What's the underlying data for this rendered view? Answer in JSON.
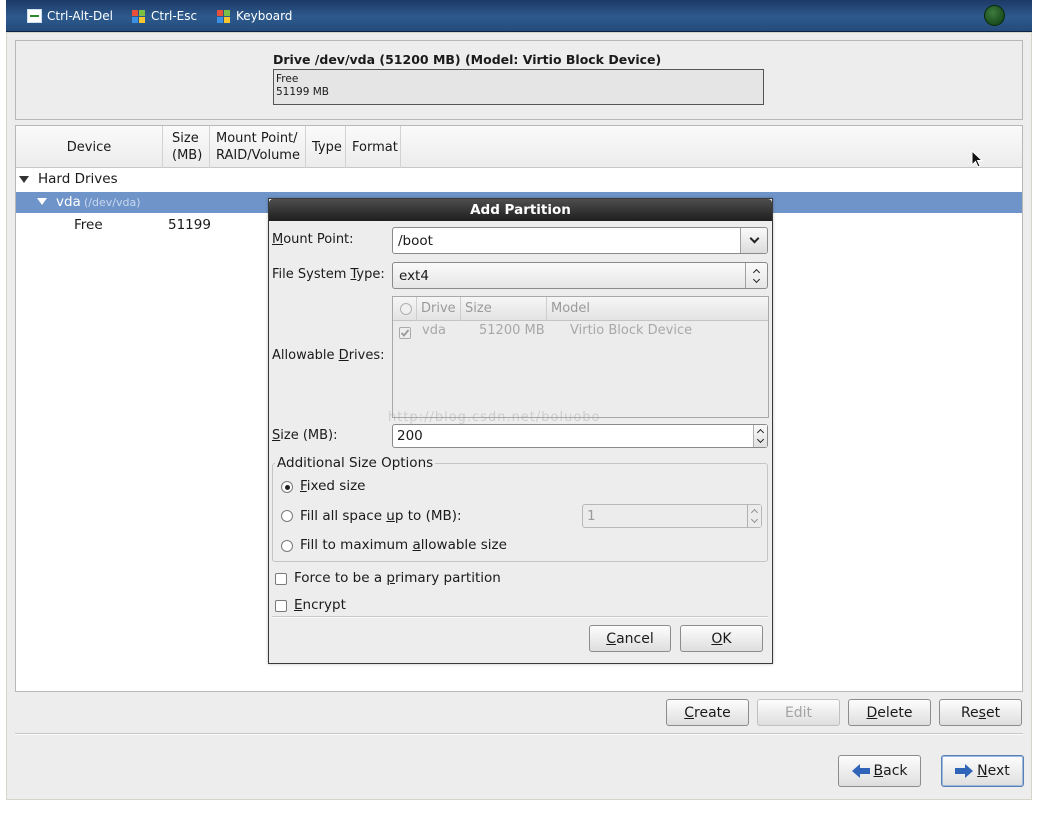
{
  "toolbar": {
    "items": [
      {
        "label": "Ctrl-Alt-Del",
        "icon": "monitor-icon"
      },
      {
        "label": "Ctrl-Esc",
        "icon": "windows-flag-icon"
      },
      {
        "label": "Keyboard",
        "icon": "windows-flag-icon"
      }
    ],
    "status_icon": "connection-led-icon"
  },
  "drive_map": {
    "title": "Drive /dev/vda (51200 MB) (Model: Virtio Block Device)",
    "segment_label": "Free",
    "segment_size": "51199 MB"
  },
  "tree": {
    "columns": [
      "Device",
      "Size\n(MB)",
      "Mount Point/\nRAID/Volume",
      "Type",
      "Format"
    ],
    "col_device": "Device",
    "col_size_1": "Size",
    "col_size_2": "(MB)",
    "col_mount_1": "Mount Point/",
    "col_mount_2": "RAID/Volume",
    "col_type": "Type",
    "col_format": "Format",
    "group": "Hard Drives",
    "drive_name": "vda",
    "drive_path": "(/dev/vda)",
    "free_label": "Free",
    "free_size": "51199"
  },
  "dialog": {
    "title": "Add Partition",
    "mount_point_label_m": "M",
    "mount_point_label_rest": "ount Point:",
    "mount_point_value": "/boot",
    "fs_type_label_pre": "File System ",
    "fs_type_label_t": "T",
    "fs_type_label_post": "ype:",
    "fs_type_value": "ext4",
    "allowable_label_pre": "Allowable ",
    "allowable_label_d": "D",
    "allowable_label_post": "rives:",
    "drives_columns": {
      "drive": "Drive",
      "size": "Size",
      "model": "Model"
    },
    "drives_rows": [
      {
        "checked": true,
        "drive": "vda",
        "size": "51200 MB",
        "model": "Virtio Block Device"
      }
    ],
    "size_label_s": "S",
    "size_label_rest": "ize (MB):",
    "size_value": "200",
    "watermark": "http://blog.csdn.net/boluobo",
    "additional_options_title": "Additional Size Options",
    "opt_fixed_f": "F",
    "opt_fixed_rest": "ixed size",
    "opt_fill_pre": "Fill all space ",
    "opt_fill_u": "u",
    "opt_fill_post": "p to (MB):",
    "opt_fill_value": "1",
    "opt_max_pre": "Fill to maximum ",
    "opt_max_a": "a",
    "opt_max_post": "llowable size",
    "selected_option": "fixed",
    "force_primary_pre": "Force to be a ",
    "force_primary_p": "p",
    "force_primary_post": "rimary partition",
    "encrypt_e": "E",
    "encrypt_rest": "ncrypt",
    "cancel_c": "C",
    "cancel_rest": "ancel",
    "ok_o": "O",
    "ok_rest": "K"
  },
  "actions": {
    "create_c": "C",
    "create_rest": "reate",
    "edit": "Edit",
    "delete_d": "D",
    "delete_rest": "elete",
    "reset_pre": "Re",
    "reset_s": "s",
    "reset_post": "et"
  },
  "nav": {
    "back_b": "B",
    "back_rest": "ack",
    "next_n": "N",
    "next_rest": "ext"
  },
  "colors": {
    "toolbar": "#2d5a8e",
    "selected_row": "#6f94c9",
    "dialog_title": "#2a2a2a",
    "arrow_icon": "#2f64b8"
  }
}
